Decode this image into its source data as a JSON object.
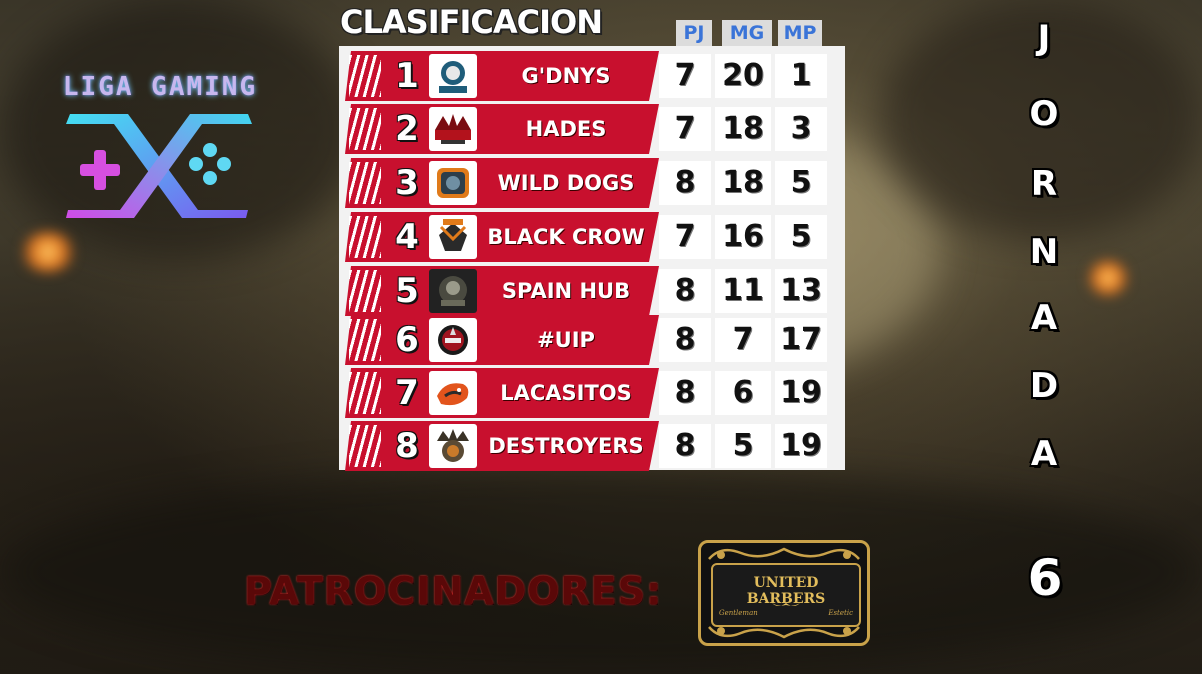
{
  "logo": {
    "text": "LIGA GAMING"
  },
  "table": {
    "title": "CLASIFICACION",
    "columns": {
      "pj": "PJ",
      "mg": "MG",
      "mp": "MP"
    },
    "rows": [
      {
        "pos": "1",
        "team": "G'DNYS",
        "pj": "7",
        "mg": "20",
        "mp": "1",
        "logo_icon": "gdny-logo"
      },
      {
        "pos": "2",
        "team": "HADES",
        "pj": "7",
        "mg": "18",
        "mp": "3",
        "logo_icon": "hades-logo"
      },
      {
        "pos": "3",
        "team": "WILD DOGS",
        "pj": "8",
        "mg": "18",
        "mp": "5",
        "logo_icon": "wild-dogs-logo"
      },
      {
        "pos": "4",
        "team": "BLACK CROW",
        "pj": "7",
        "mg": "16",
        "mp": "5",
        "logo_icon": "black-crow-logo"
      },
      {
        "pos": "5",
        "team": "SPAIN HUB",
        "pj": "8",
        "mg": "11",
        "mp": "13",
        "logo_icon": "spain-hub-logo"
      },
      {
        "pos": "6",
        "team": "#UIP",
        "pj": "8",
        "mg": "7",
        "mp": "17",
        "logo_icon": "uip-logo"
      },
      {
        "pos": "7",
        "team": "LACASITOS",
        "pj": "8",
        "mg": "6",
        "mp": "19",
        "logo_icon": "lacasitos-logo"
      },
      {
        "pos": "8",
        "team": "DESTROYERS",
        "pj": "8",
        "mg": "5",
        "mp": "19",
        "logo_icon": "destroyers-logo"
      }
    ]
  },
  "jornada": {
    "letters": [
      "J",
      "O",
      "R",
      "N",
      "A",
      "D",
      "A"
    ],
    "number": "6"
  },
  "sponsors": {
    "label": "PATROCINADORES:",
    "barber": {
      "name": "UNITED BARBERS",
      "left_sub": "Gentleman",
      "right_sub": "Estetic"
    }
  },
  "colors": {
    "row_red": "#c8102e",
    "header_blue": "#3a74d8",
    "gold": "#c9a24a"
  }
}
